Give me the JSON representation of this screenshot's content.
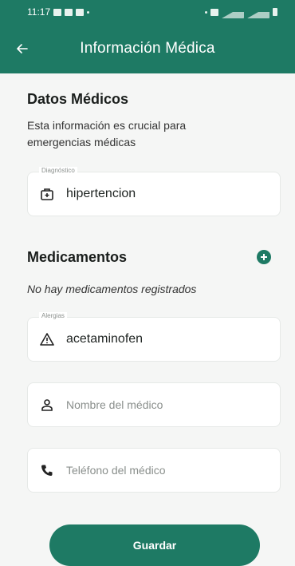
{
  "status_bar": {
    "time": "11:17"
  },
  "app_bar": {
    "title": "Información Médica",
    "back_icon": "arrow-back-icon"
  },
  "datos": {
    "title": "Datos Médicos",
    "description": "Esta información es crucial para emergencias médicas"
  },
  "diagnostico": {
    "label": "Diagnóstico",
    "value": "hipertencion",
    "icon": "medical-bag-icon"
  },
  "medicamentos": {
    "title": "Medicamentos",
    "empty_text": "No hay medicamentos registrados",
    "add_icon": "add-circle-icon"
  },
  "alergias": {
    "label": "Alergias",
    "value": "acetaminofen",
    "icon": "warning-icon"
  },
  "medico_nombre": {
    "placeholder": "Nombre del médico",
    "icon": "person-icon"
  },
  "medico_telefono": {
    "placeholder": "Teléfono del médico",
    "icon": "phone-icon"
  },
  "save_button": {
    "label": "Guardar"
  },
  "colors": {
    "primary": "#1e7a64",
    "background": "#f5f6f5",
    "card": "#ffffff"
  }
}
